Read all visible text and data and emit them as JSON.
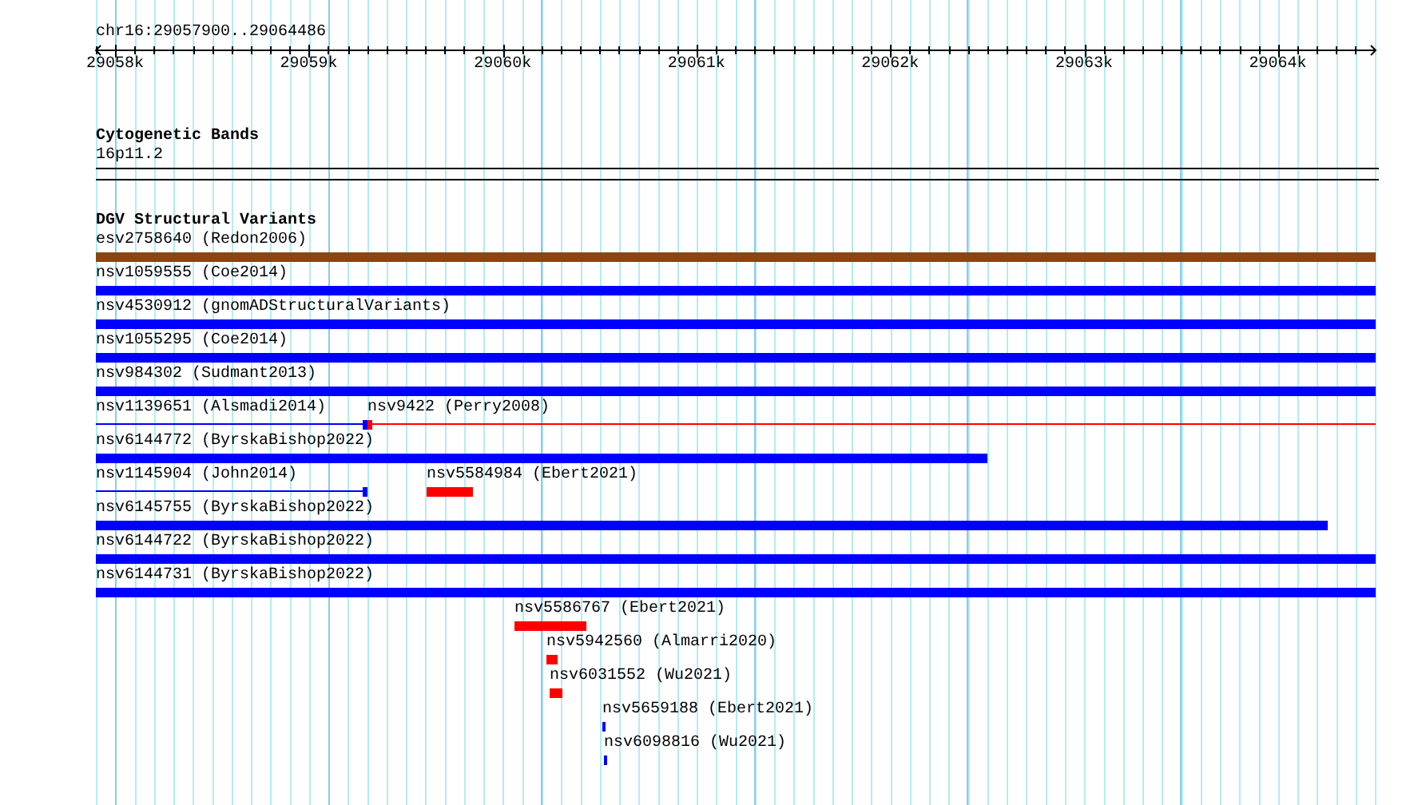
{
  "ruler": {
    "location": "chr16:29057900..29064486",
    "ticks": [
      "29058k",
      "29059k",
      "29060k",
      "29061k",
      "29062k",
      "29063k",
      "29064k"
    ]
  },
  "cytoband_track": {
    "title": "Cytogenetic Bands",
    "band": "16p11.2"
  },
  "variant_track": {
    "title": "DGV Structural Variants",
    "rows": [
      {
        "features": [
          {
            "label": "esv2758640 (Redon2006)",
            "kind": "bar",
            "color": "#8b4513"
          }
        ]
      },
      {
        "features": [
          {
            "label": "nsv1059555 (Coe2014)",
            "kind": "bar",
            "color": "#0000ff"
          }
        ]
      },
      {
        "features": [
          {
            "label": "nsv4530912 (gnomADStructuralVariants)",
            "kind": "bar",
            "color": "#0000ff"
          }
        ]
      },
      {
        "features": [
          {
            "label": "nsv1055295 (Coe2014)",
            "kind": "bar",
            "color": "#0000ff"
          }
        ]
      },
      {
        "features": [
          {
            "label": "nsv984302 (Sudmant2013)",
            "kind": "bar",
            "color": "#0000ff"
          }
        ]
      },
      {
        "features": [
          {
            "label": "nsv1139651 (Alsmadi2014)",
            "kind": "line",
            "color": "#0000ff"
          },
          {
            "label": "nsv9422 (Perry2008)",
            "kind": "line",
            "color": "#ff0000"
          }
        ]
      },
      {
        "features": [
          {
            "label": "nsv6144772 (ByrskaBishop2022)",
            "kind": "bar",
            "color": "#0000ff"
          }
        ]
      },
      {
        "features": [
          {
            "label": "nsv1145904 (John2014)",
            "kind": "line",
            "color": "#0000ff"
          },
          {
            "label": "nsv5584984 (Ebert2021)",
            "kind": "bar",
            "color": "#ff0000"
          }
        ]
      },
      {
        "features": [
          {
            "label": "nsv6145755 (ByrskaBishop2022)",
            "kind": "bar",
            "color": "#0000ff"
          }
        ]
      },
      {
        "features": [
          {
            "label": "nsv6144722 (ByrskaBishop2022)",
            "kind": "bar",
            "color": "#0000ff"
          }
        ]
      },
      {
        "features": [
          {
            "label": "nsv6144731 (ByrskaBishop2022)",
            "kind": "bar",
            "color": "#0000ff"
          }
        ]
      },
      {
        "features": [
          {
            "label": "nsv5586767 (Ebert2021)",
            "kind": "bar",
            "color": "#ff0000"
          }
        ]
      },
      {
        "features": [
          {
            "label": "nsv5942560 (Almarri2020)",
            "kind": "bar",
            "color": "#ff0000"
          }
        ]
      },
      {
        "features": [
          {
            "label": "nsv6031552 (Wu2021)",
            "kind": "bar",
            "color": "#ff0000"
          }
        ]
      },
      {
        "features": [
          {
            "label": "nsv5659188 (Ebert2021)",
            "kind": "bar",
            "color": "#0000ff"
          }
        ]
      },
      {
        "features": [
          {
            "label": "nsv6098816 (Wu2021)",
            "kind": "bar",
            "color": "#0000ff"
          }
        ]
      }
    ]
  }
}
